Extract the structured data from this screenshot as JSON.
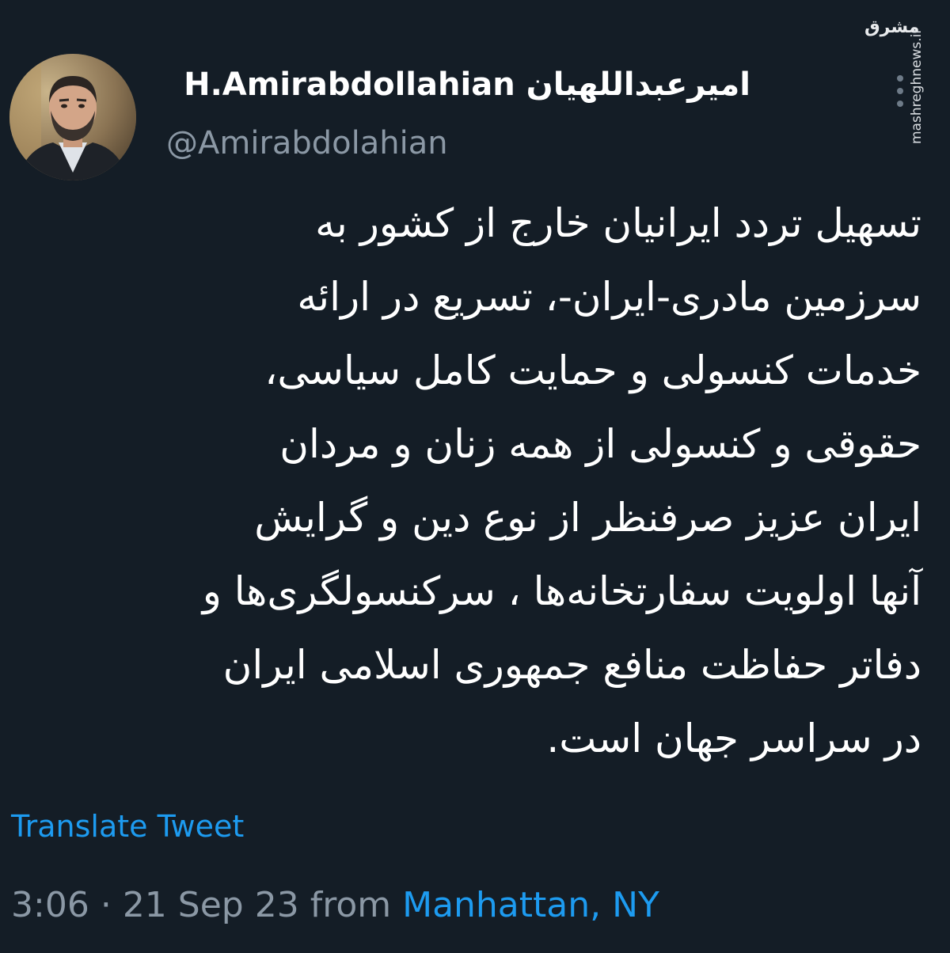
{
  "tweet": {
    "display_name": "H.Amirabdollahian امیرعبداللهیان",
    "handle": "@Amirabdolahian",
    "text": "تسهیل تردد ایرانیان خارج از کشور به\nسرزمین مادری-ایران-، تسریع در ارائه\nخدمات کنسولی و حمایت کامل سیاسی،\nحقوقی و کنسولی از همه زنان و مردان\nایران عزیز صرفنظر از نوع دین و گرایش\nآنها اولویت سفارتخانه‌ها ، سرکنسولگری‌ها و\nدفاتر حفاظت منافع جمهوری اسلامی ایران\nدر سراسر جهان است.",
    "translate_label": "Translate Tweet",
    "time": "3:06",
    "separator": "·",
    "date": "21 Sep 23",
    "from_label": "from",
    "location": "Manhattan, NY"
  },
  "watermark": {
    "logo_text": "مشرق",
    "url": "mashreghnews.ir"
  },
  "colors": {
    "background": "#141d26",
    "link": "#1d9bf0",
    "secondary_text": "#8b98a5"
  },
  "icons": {
    "more": "more-vertical-icon",
    "avatar": "profile-avatar"
  }
}
